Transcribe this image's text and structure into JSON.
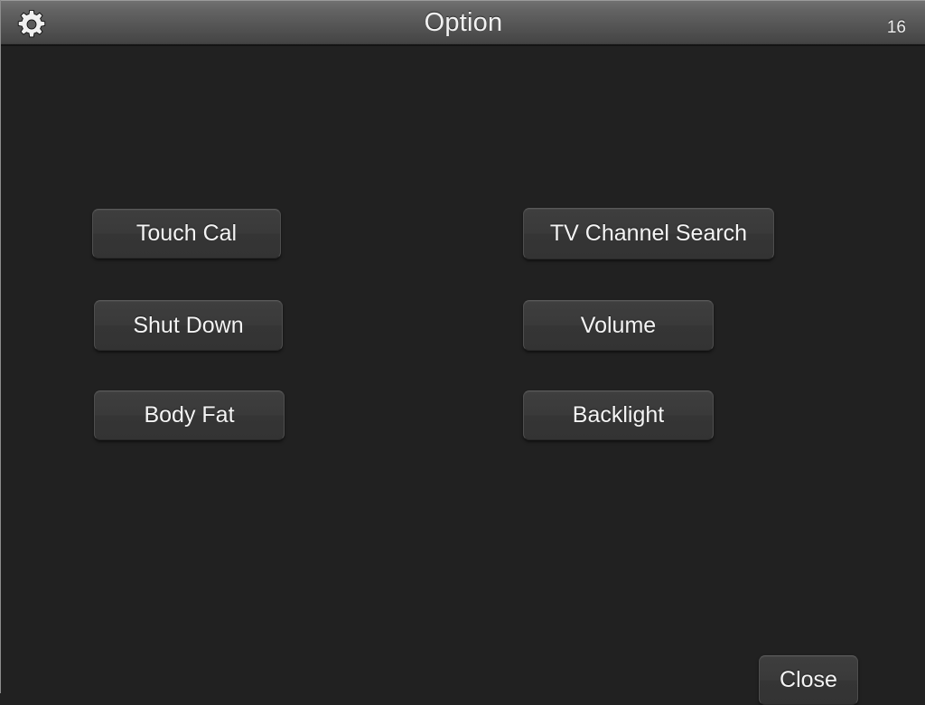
{
  "window": {
    "background_color": "#212121"
  },
  "title_bar": {
    "title": "Option",
    "badge_count": "16",
    "gear_icon_name": "gear-icon",
    "gradient_top_color": "#717171",
    "gradient_bottom_color": "#454545",
    "text_color": "#f2f2f2"
  },
  "main": {
    "button_fill_color": "#3a3a3a",
    "button_border_color": "#4e4e4e",
    "button_text_color": "#f4f4f4",
    "columns": [
      {
        "name": "left-column",
        "buttons": [
          {
            "id": "touch-cal",
            "label": "Touch Cal"
          },
          {
            "id": "shut-down",
            "label": "Shut Down"
          },
          {
            "id": "body-fat",
            "label": "Body Fat"
          }
        ]
      },
      {
        "name": "right-column",
        "buttons": [
          {
            "id": "tv-channel-search",
            "label": "TV Channel Search"
          },
          {
            "id": "volume",
            "label": "Volume"
          },
          {
            "id": "backlight",
            "label": "Backlight"
          }
        ]
      }
    ]
  },
  "footer": {
    "close_label": "Close"
  }
}
